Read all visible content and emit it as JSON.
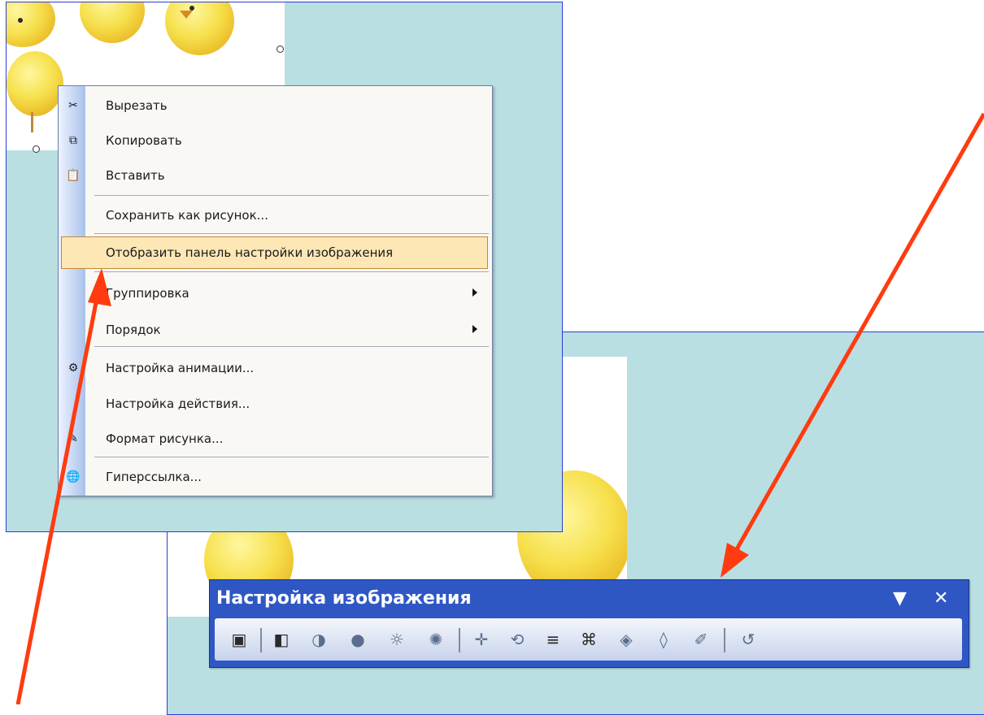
{
  "context_menu": {
    "items": [
      {
        "label": "Вырезать",
        "icon": "scissors-icon",
        "glyph": "✂"
      },
      {
        "label": "Копировать",
        "icon": "copy-icon",
        "glyph": "⧉"
      },
      {
        "label": "Вставить",
        "icon": "paste-icon",
        "glyph": "📋"
      },
      {
        "label": "Сохранить как рисунок..."
      },
      {
        "label": "Отобразить панель настройки изображения",
        "highlighted": true
      },
      {
        "label": "Группировка",
        "submenu": true
      },
      {
        "label": "Порядок",
        "submenu": true
      },
      {
        "label": "Настройка анимации...",
        "icon": "animation-icon",
        "glyph": "⚙"
      },
      {
        "label": "Настройка действия..."
      },
      {
        "label": "Формат рисунка...",
        "icon": "format-picture-icon",
        "glyph": "✎"
      },
      {
        "label": "Гиперссылка...",
        "icon": "hyperlink-icon",
        "glyph": "🌐"
      }
    ]
  },
  "toolbar": {
    "title": "Настройка изображения",
    "menu_glyph": "▼",
    "close_glyph": "✕",
    "buttons": [
      {
        "name": "insert-picture-icon",
        "glyph": "▣",
        "enabled": true
      },
      {
        "name": "color-icon",
        "glyph": "◧",
        "enabled": true
      },
      {
        "name": "more-contrast-icon",
        "glyph": "◑",
        "enabled": false
      },
      {
        "name": "less-contrast-icon",
        "glyph": "●",
        "enabled": false
      },
      {
        "name": "more-brightness-icon",
        "glyph": "☼",
        "enabled": false
      },
      {
        "name": "less-brightness-icon",
        "glyph": "✺",
        "enabled": false
      },
      {
        "name": "crop-icon",
        "glyph": "✛",
        "enabled": false
      },
      {
        "name": "rotate-icon",
        "glyph": "⟲",
        "enabled": false
      },
      {
        "name": "line-style-icon",
        "glyph": "≡",
        "enabled": true
      },
      {
        "name": "compress-pictures-icon",
        "glyph": "⌘",
        "enabled": true
      },
      {
        "name": "recolor-icon",
        "glyph": "◈",
        "enabled": false
      },
      {
        "name": "format-picture-icon",
        "glyph": "◊",
        "enabled": false
      },
      {
        "name": "set-transparent-color-icon",
        "glyph": "✐",
        "enabled": false
      },
      {
        "name": "reset-picture-icon",
        "glyph": "↺",
        "enabled": false
      }
    ]
  },
  "colors": {
    "slide_background": "#b9dfe2",
    "menu_highlight": "#fde7b4",
    "toolbar_title_bar": "#2f57c4",
    "annotation_arrow": "#ff3b0f"
  }
}
